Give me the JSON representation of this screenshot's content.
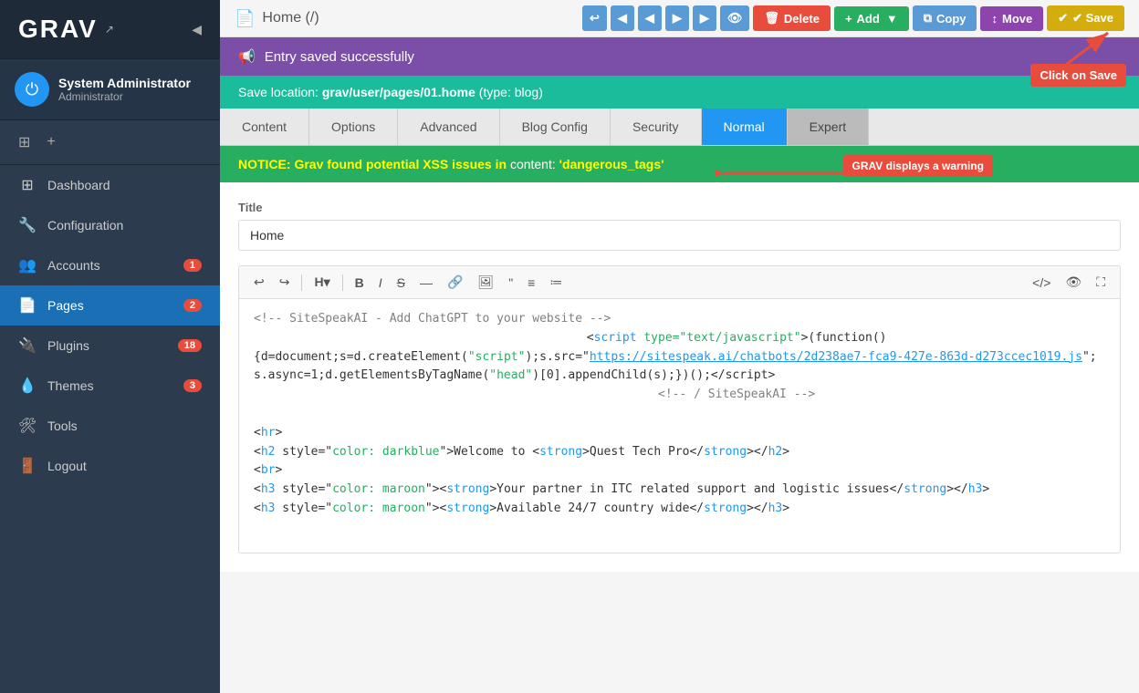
{
  "sidebar": {
    "logo_text": "GRAV",
    "collapse_icon": "◀",
    "user": {
      "name": "System Administrator",
      "role": "Administrator"
    },
    "nav_items": [
      {
        "id": "dashboard",
        "icon": "⊞",
        "label": "Dashboard",
        "badge": null,
        "active": false
      },
      {
        "id": "configuration",
        "icon": "🔧",
        "label": "Configuration",
        "badge": null,
        "active": false
      },
      {
        "id": "accounts",
        "icon": "👥",
        "label": "Accounts",
        "badge": "1",
        "active": false
      },
      {
        "id": "pages",
        "icon": "📄",
        "label": "Pages",
        "badge": "2",
        "active": true
      },
      {
        "id": "plugins",
        "icon": "🔌",
        "label": "Plugins",
        "badge": "18",
        "active": false
      },
      {
        "id": "themes",
        "icon": "💧",
        "label": "Themes",
        "badge": "3",
        "active": false
      },
      {
        "id": "tools",
        "icon": "🛠",
        "label": "Tools",
        "badge": null,
        "active": false
      },
      {
        "id": "logout",
        "icon": "🚪",
        "label": "Logout",
        "badge": null,
        "active": false
      }
    ]
  },
  "toolbar": {
    "page_title": "Home (/)",
    "page_icon": "📄",
    "buttons": {
      "back": "↩",
      "prev1": "◀",
      "prev2": "◀",
      "next1": "▶",
      "next2": "▶",
      "preview": "👁",
      "delete": "Delete",
      "add": "+ Add",
      "copy": "Copy",
      "move": "Move",
      "save": "✔ Save"
    },
    "save_annotation": "Click on Save"
  },
  "alerts": {
    "success_message": "Entry saved successfully",
    "save_location_prefix": "Save location:",
    "save_location_path": "grav/user/pages/01.home",
    "save_location_type": "type: blog",
    "xss_notice": "NOTICE: Grav found potential XSS issues in",
    "xss_content_label": "content:",
    "xss_content_value": "'dangerous_tags'",
    "warning_annotation": "GRAV displays a warning"
  },
  "tabs": [
    {
      "id": "content",
      "label": "Content",
      "active": false
    },
    {
      "id": "options",
      "label": "Options",
      "active": false
    },
    {
      "id": "advanced",
      "label": "Advanced",
      "active": false
    },
    {
      "id": "blog-config",
      "label": "Blog Config",
      "active": false
    },
    {
      "id": "security",
      "label": "Security",
      "active": false
    },
    {
      "id": "normal",
      "label": "Normal",
      "active": true
    },
    {
      "id": "expert",
      "label": "Expert",
      "active": false
    }
  ],
  "form": {
    "title_label": "Title",
    "title_value": "Home",
    "editor_content_lines": [
      {
        "type": "comment",
        "text": "<!-- SiteSpeakAI - Add ChatGPT to your website -->"
      },
      {
        "type": "tag",
        "text": "                <script type=\"text/javascript\">(function()"
      },
      {
        "type": "mixed",
        "text": "{d=document;s=d.createElement(\"script\");s.src=\"https://sitespeak.ai/chatbots/2d238ae7-fca9-427e-863d-d273ccec1019.js\";s.async=1;d.getElementsByTagName(\"head\")[0].appendChild(s);})();<\\/script>"
      },
      {
        "type": "comment",
        "text": "                <!-- / SiteSpeakAI -->"
      },
      {
        "type": "blank",
        "text": ""
      },
      {
        "type": "tag",
        "text": "<hr>"
      },
      {
        "type": "mixed",
        "text": "<h2 style=\"color: darkblue\">Welcome to <strong>Quest Tech Pro</strong></h2>"
      },
      {
        "type": "tag",
        "text": "<br>"
      },
      {
        "type": "mixed",
        "text": "<h3 style=\"color: maroon\"><strong>Your partner in ITC related support and logistic issues</strong></h3>"
      },
      {
        "type": "mixed",
        "text": "<h3 style=\"color: maroon\"><strong>Available 24/7 country wide</strong></h3>"
      }
    ]
  },
  "colors": {
    "sidebar_bg": "#2d3b4e",
    "sidebar_active": "#1a6fb5",
    "toolbar_bg": "#f5f5f5",
    "btn_delete": "#e74c3c",
    "btn_add": "#27ae60",
    "btn_copy": "#5b9bd5",
    "btn_move": "#8e44ad",
    "btn_save": "#d4ac0d",
    "alert_success_bg": "#7b4fa8",
    "alert_info_bg": "#1abc9c",
    "alert_warning_bg": "#27ae60",
    "annotation_red": "#e74c3c",
    "tab_active": "#2196F3"
  }
}
